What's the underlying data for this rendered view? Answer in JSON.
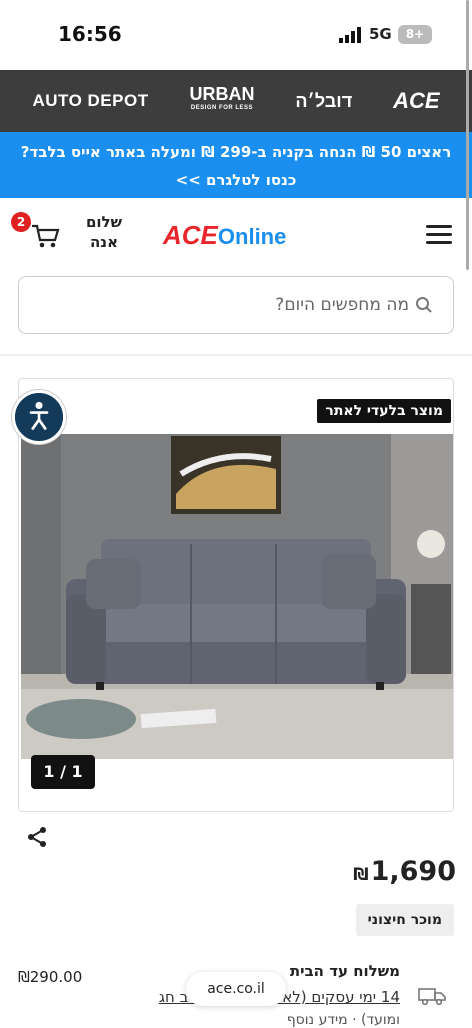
{
  "status": {
    "time": "16:56",
    "network": "5G",
    "battery": "8+"
  },
  "brands": {
    "auto_depot": "AUTO DEPOT",
    "urban": "URBAN",
    "urban_tag": "DESIGN FOR LESS",
    "dubale": "דובל׳ה",
    "ace": "ACE"
  },
  "promo": {
    "text": "ראצים 50 ₪ הנחה בקניה ב-299 ₪ ומעלה באתר אייס בלבד? כנסו לטלגרם >>"
  },
  "header": {
    "logo_ace": "ACE",
    "logo_online": "Online",
    "greeting": "שלום אנה",
    "cart_count": "2"
  },
  "search": {
    "placeholder": "מה מחפשים היום?"
  },
  "product": {
    "exclusive_badge": "מוצר בלעדי לאתר",
    "image_counter": "1 / 1",
    "price": "1,690",
    "currency": "₪",
    "seller_badge": "מוכר חיצוני"
  },
  "shipping": {
    "title": "משלוח עד הבית",
    "time": "14 ימי עסקים (לא כולל שישי, ערב חג",
    "more": "ומועד) · מידע נוסף",
    "price": "₪290.00"
  },
  "url_pill": "ace.co.il",
  "colors": {
    "promo_bg": "#1a8ff0",
    "brandbar_bg": "#3d3d3d",
    "ace_red": "#e8262b",
    "accent_blue": "#1a8ff0"
  }
}
